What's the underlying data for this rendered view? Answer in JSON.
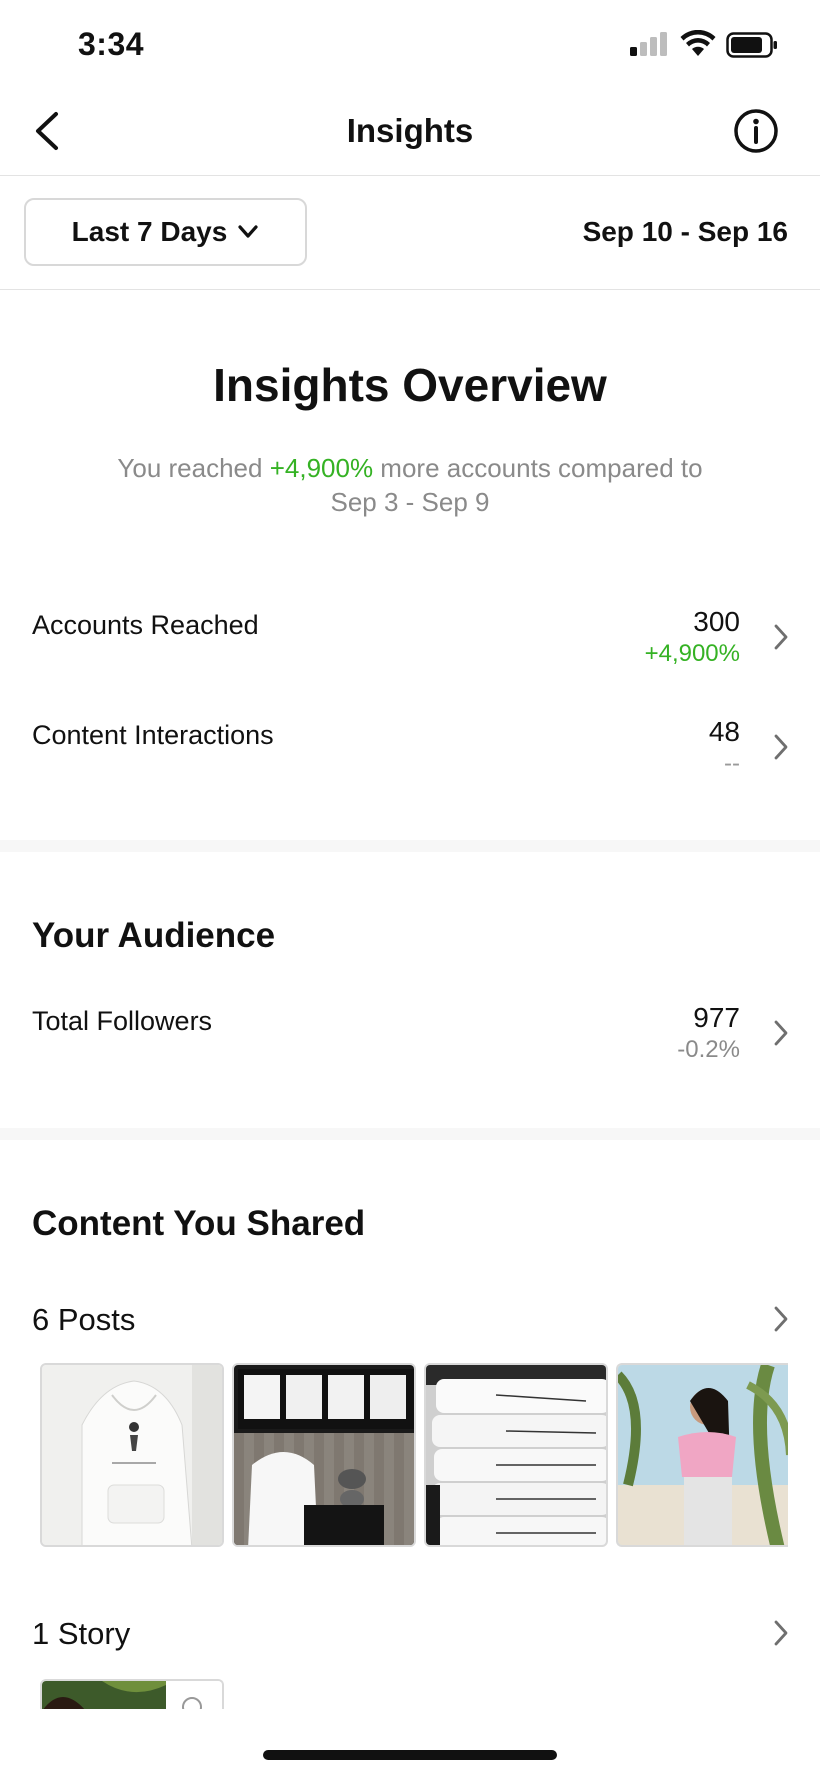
{
  "status_bar": {
    "time": "3:34"
  },
  "nav": {
    "title": "Insights"
  },
  "filter": {
    "range_label": "Last 7 Days",
    "date_range": "Sep 10 - Sep 16"
  },
  "overview": {
    "title": "Insights Overview",
    "subtitle_prefix": "You reached ",
    "subtitle_highlight": "+4,900%",
    "subtitle_suffix": " more accounts compared to",
    "subtitle_line2": "Sep 3 - Sep 9"
  },
  "metrics": [
    {
      "label": "Accounts Reached",
      "value": "300",
      "change": "+4,900%",
      "change_color": "#35b224"
    },
    {
      "label": "Content Interactions",
      "value": "48",
      "change": "--",
      "change_color": "#9a9a9a"
    }
  ],
  "audience": {
    "title": "Your Audience",
    "label": "Total Followers",
    "value": "977",
    "change": "-0.2%",
    "change_color": "#8a8a8a"
  },
  "content": {
    "title": "Content You Shared",
    "posts_label": "6 Posts",
    "posts": [
      {
        "name": "white-hoodie-post"
      },
      {
        "name": "hoodie-collage-post"
      },
      {
        "name": "folded-shirts-post"
      },
      {
        "name": "pink-shirt-model-post"
      }
    ],
    "story_label": "1 Story"
  },
  "icons": {
    "back": "chevron-left-icon",
    "info": "info-icon",
    "dropdown": "chevron-down-icon",
    "row_chevron": "chevron-right-icon"
  },
  "colors": {
    "accent_green": "#35b224",
    "muted_text": "#8a8a8a"
  }
}
